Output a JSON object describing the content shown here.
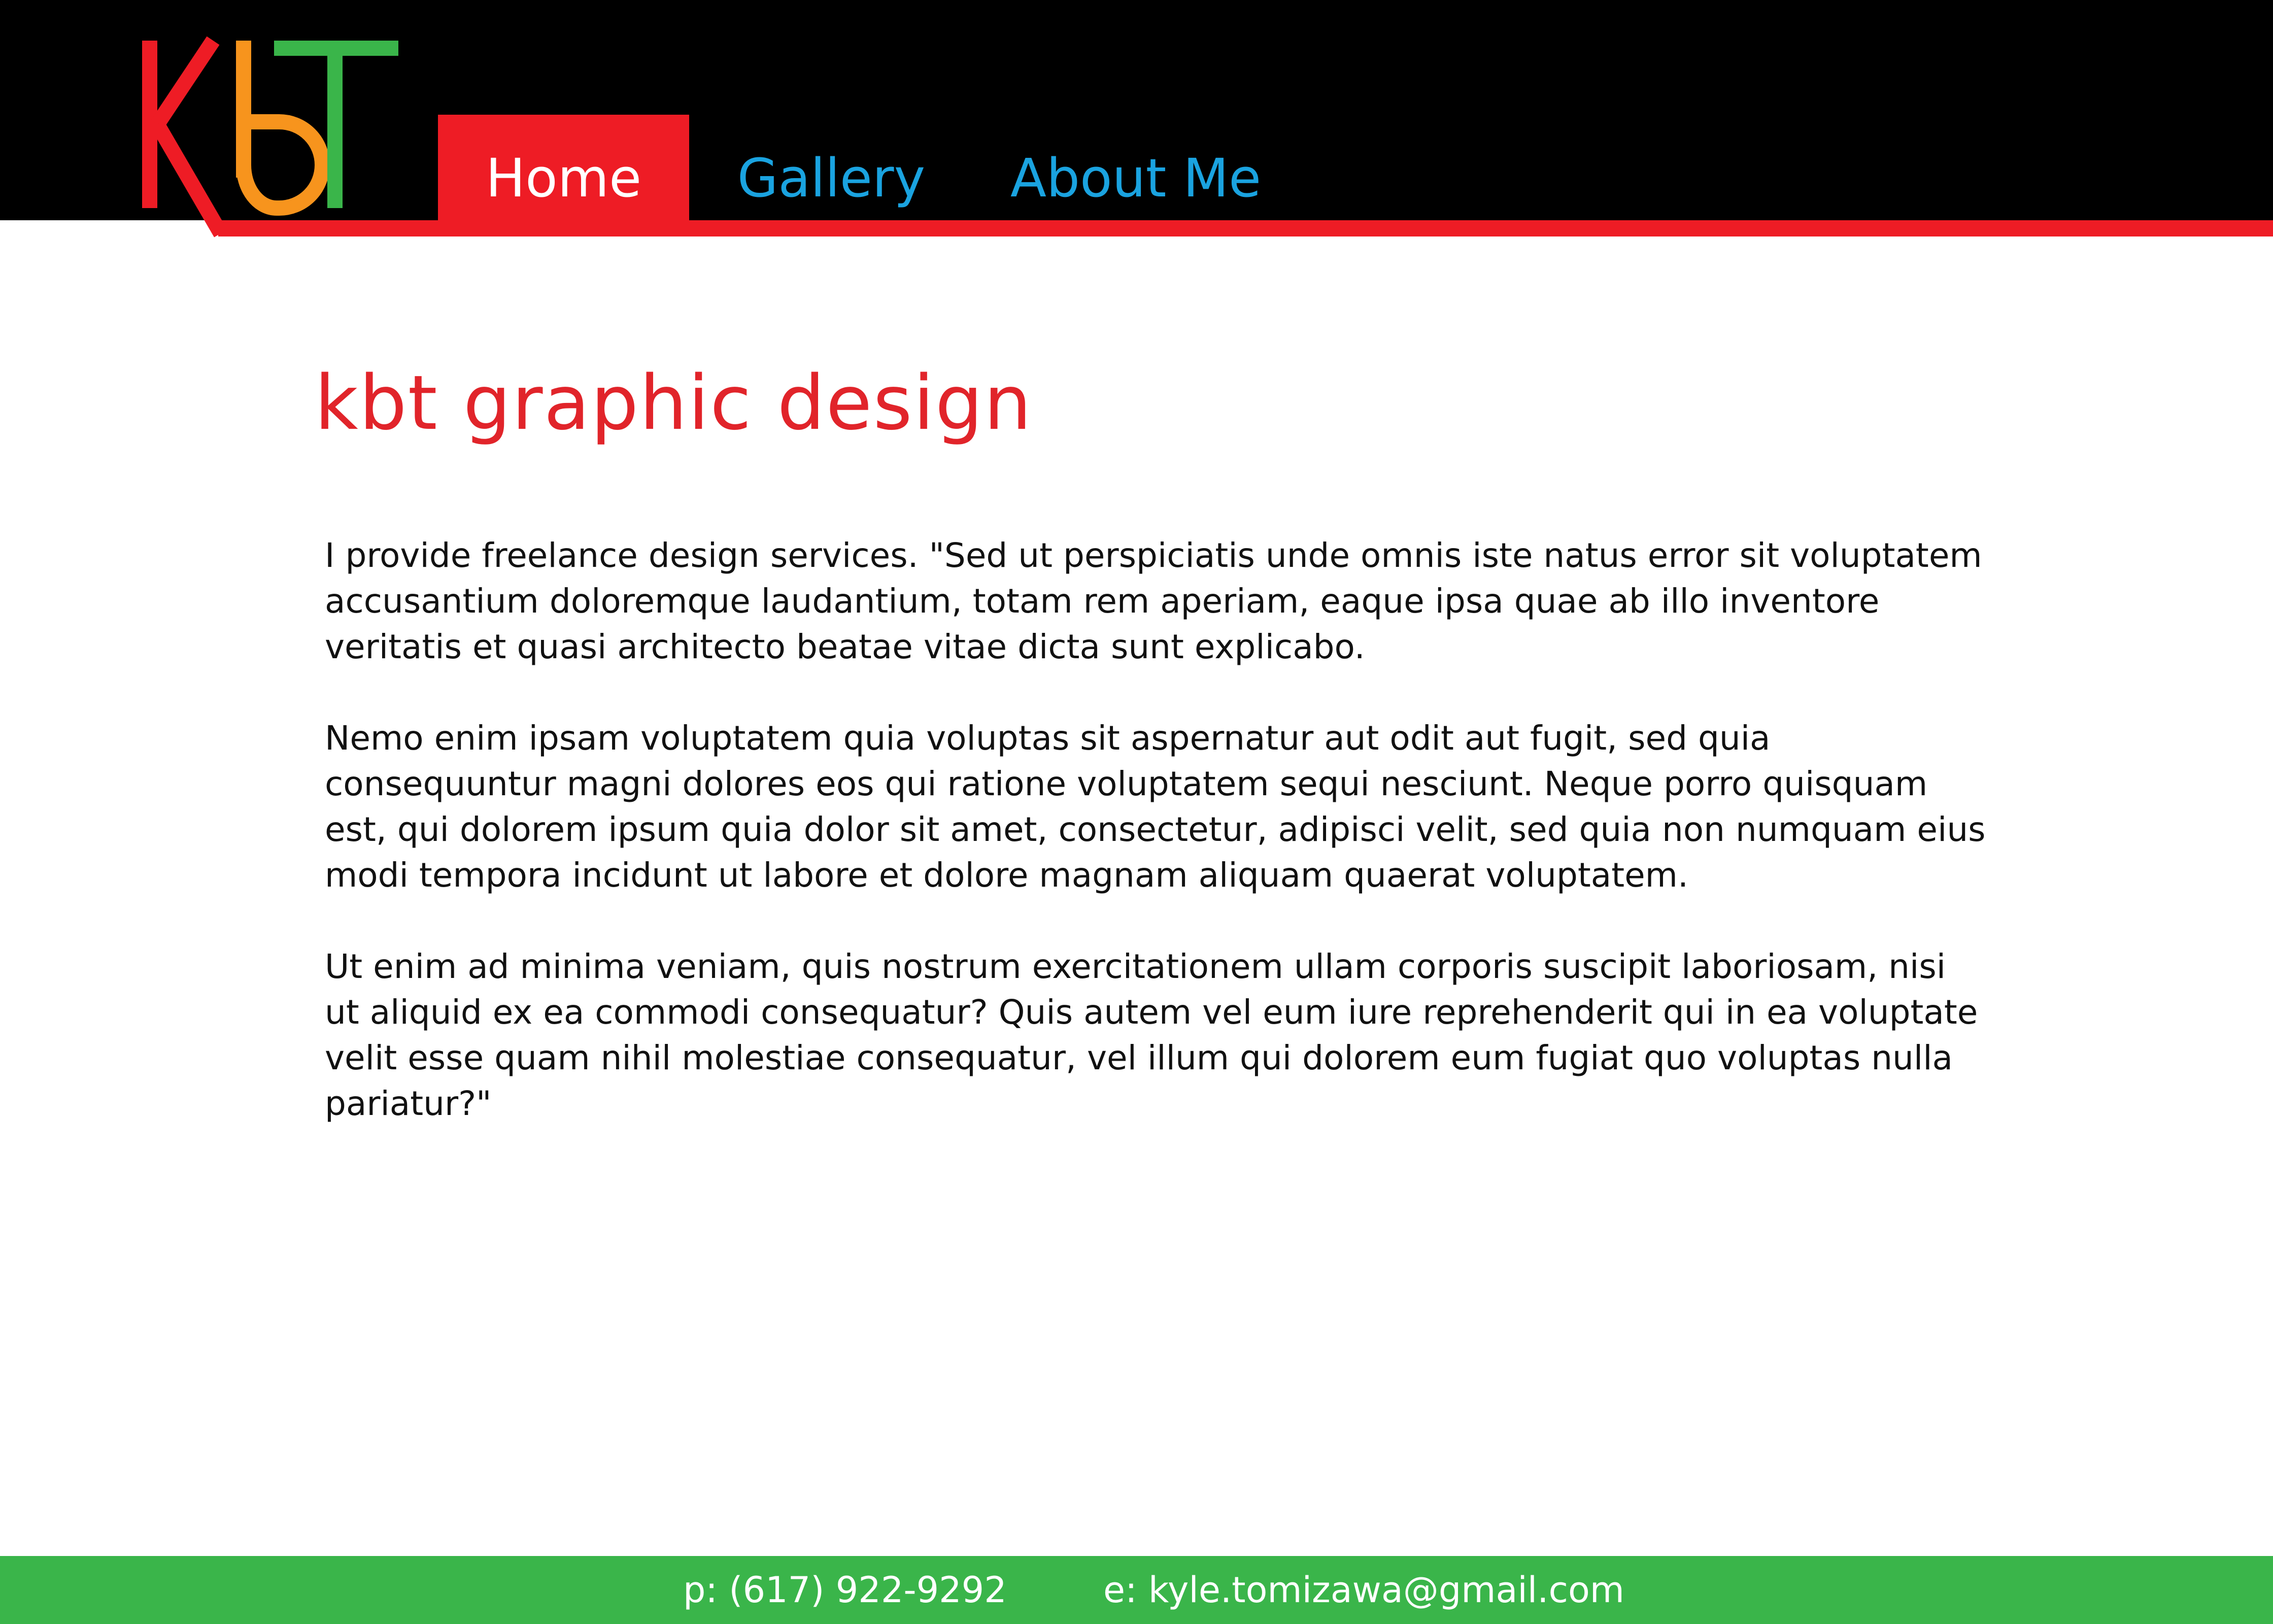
{
  "colors": {
    "header_bg": "#000000",
    "accent_red": "#ee1c25",
    "nav_link": "#1aa3e0",
    "logo_orange": "#f7941d",
    "logo_green": "#3ab54a",
    "footer_bg": "#3ab54a"
  },
  "logo": {
    "text": "KbT",
    "icon": "kbt-logo"
  },
  "nav": {
    "items": [
      {
        "label": "Home",
        "active": true
      },
      {
        "label": "Gallery",
        "active": false
      },
      {
        "label": "About Me",
        "active": false
      }
    ]
  },
  "main": {
    "title": "kbt graphic design",
    "paragraphs": [
      "I provide freelance design services.  \"Sed ut perspiciatis unde omnis iste natus error sit voluptatem accusantium doloremque laudantium, totam rem aperiam, eaque ipsa quae ab illo inventore veritatis et quasi architecto beatae vitae dicta sunt explicabo.",
      "Nemo enim ipsam voluptatem quia voluptas sit aspernatur aut odit aut fugit, sed quia consequuntur magni dolores eos qui ratione voluptatem sequi nesciunt. Neque porro quisquam est, qui dolorem ipsum quia dolor sit amet, consectetur, adipisci velit, sed quia non numquam eius modi tempora incidunt ut labore et dolore magnam aliquam quaerat voluptatem.",
      "Ut enim ad minima veniam, quis nostrum exercitationem ullam corporis suscipit laboriosam, nisi ut aliquid ex ea commodi consequatur? Quis autem vel eum iure reprehenderit qui in ea voluptate velit esse quam nihil molestiae consequatur, vel illum qui dolorem eum fugiat quo voluptas nulla pariatur?\""
    ]
  },
  "footer": {
    "phone": "p: (617) 922-9292",
    "email": "e: kyle.tomizawa@gmail.com"
  }
}
